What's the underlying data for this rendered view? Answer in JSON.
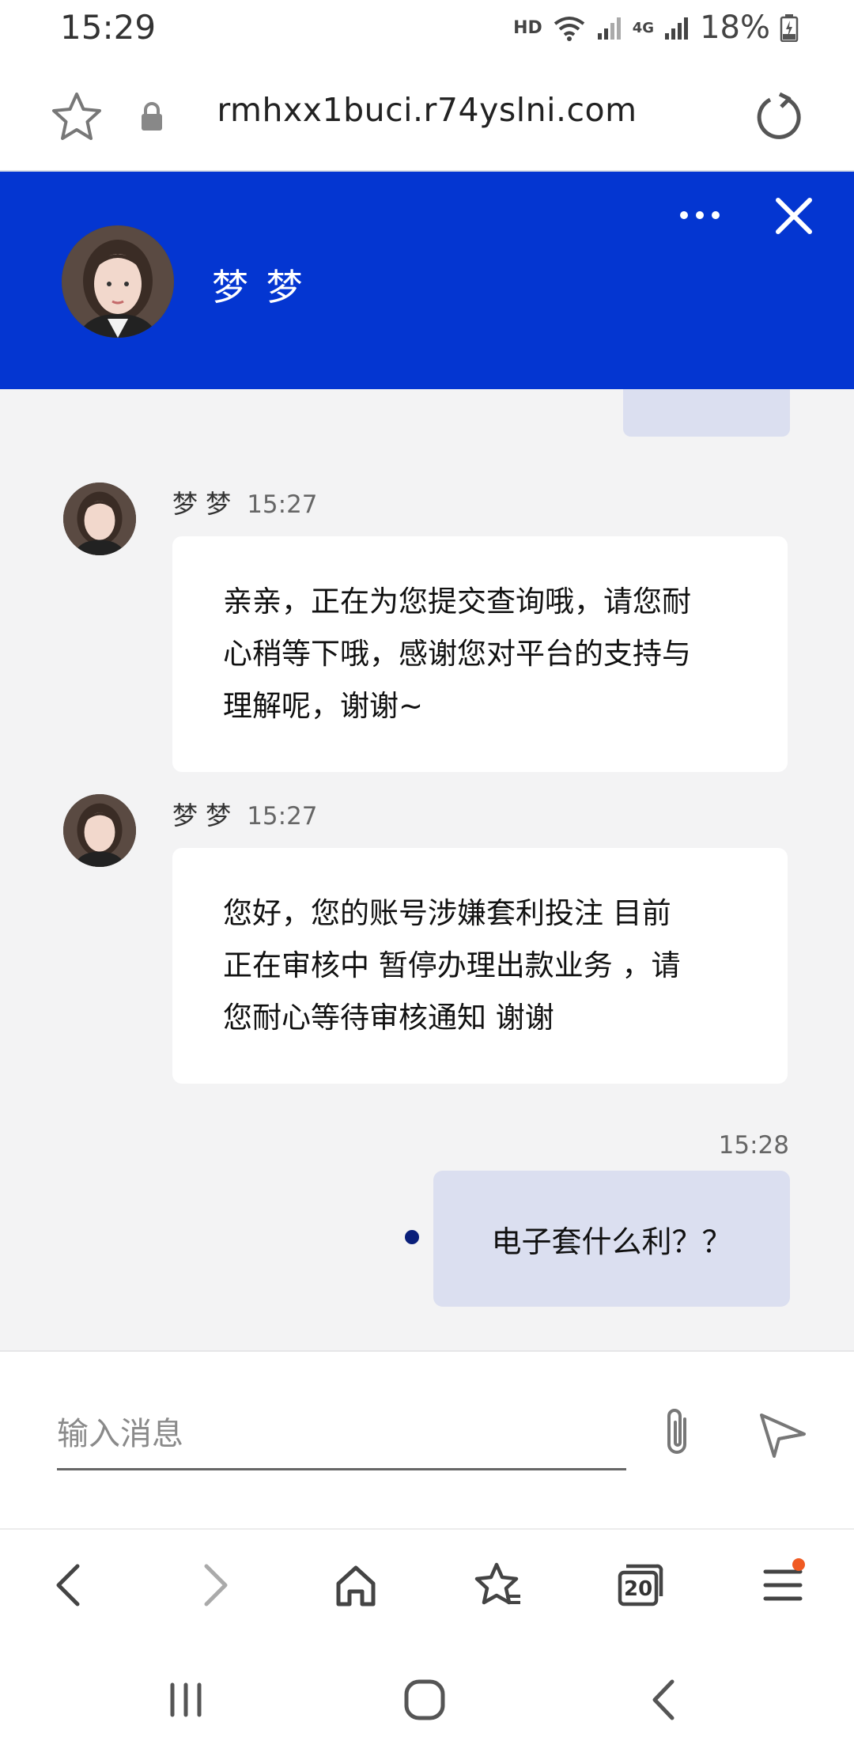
{
  "status_bar": {
    "time": "15:29",
    "hd": "HD",
    "network": "4G",
    "battery": "18%"
  },
  "browser": {
    "url": "rmhxx1buci.r74yslni.com"
  },
  "chat_header": {
    "agent_name": "梦 梦",
    "accent_color": "#0436d1"
  },
  "messages": [
    {
      "sender": "梦 梦",
      "time": "15:27",
      "lines": [
        "亲亲，正在为您提交查询哦，请您耐",
        "心稍等下哦，感谢您对平台的支持与",
        "理解呢，谢谢~"
      ]
    },
    {
      "sender": "梦 梦",
      "time": "15:27",
      "lines": [
        "您好，您的账号涉嫌套利投注 目前",
        "正在审核中 暂停办理出款业务 ，请",
        "您耐心等待审核通知 谢谢"
      ]
    }
  ],
  "outgoing": {
    "time": "15:28",
    "text": "电子套什么利？？"
  },
  "composer": {
    "placeholder": "输入消息"
  },
  "browser_toolbar": {
    "tab_count": "20"
  }
}
